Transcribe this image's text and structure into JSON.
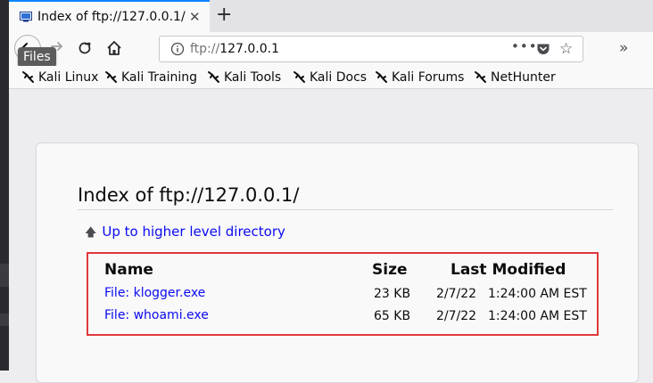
{
  "tab": {
    "title": "Index of ftp://127.0.0.1/",
    "close": "✕"
  },
  "newtab_label": "+",
  "tooltip": "Files",
  "urlbar": {
    "protocol": "ftp://",
    "host": "127.0.0.1",
    "actions": "•••"
  },
  "bookmarks": [
    "Kali Linux",
    "Kali Training",
    "Kali Tools",
    "Kali Docs",
    "Kali Forums",
    "NetHunter"
  ],
  "page": {
    "heading": "Index of ftp://127.0.0.1/",
    "up_link": "Up to higher level directory",
    "columns": {
      "name": "Name",
      "size": "Size",
      "modified": "Last Modified"
    },
    "files": [
      {
        "name": "File: klogger.exe",
        "size": "23 KB",
        "date": "2/7/22",
        "time": "1:24:00 AM EST"
      },
      {
        "name": "File: whoami.exe",
        "size": "65 KB",
        "date": "2/7/22",
        "time": "1:24:00 AM EST"
      }
    ]
  },
  "colors": {
    "accent": "#0a84ff",
    "link": "#0a0af0",
    "highlight": "#e0373b"
  },
  "icons": [
    "favicon-icon",
    "back-arrow-icon",
    "forward-arrow-icon",
    "reload-icon",
    "home-icon",
    "info-icon",
    "pocket-icon",
    "star-icon",
    "overflow-chevron-icon",
    "kali-dragon-icon",
    "up-arrow-icon"
  ]
}
